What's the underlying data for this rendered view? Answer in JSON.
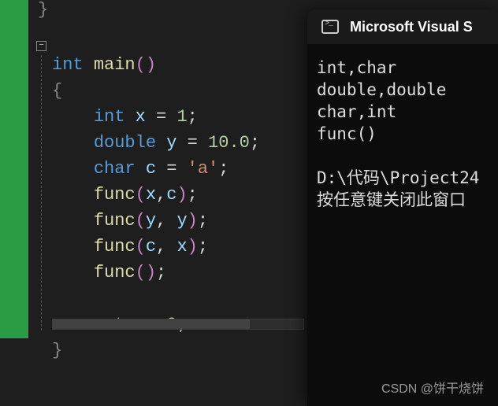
{
  "editor": {
    "fold_glyph": "−",
    "prev_brace": "}",
    "lines": {
      "l0": {
        "kw": "int",
        "fn": "main",
        "p1": "(",
        "p2": ")"
      },
      "l1": {
        "brace": "{"
      },
      "l2": {
        "kw": "int",
        "id": "x",
        "op": "=",
        "num": "1",
        "semi": ";"
      },
      "l3": {
        "kw": "double",
        "id": "y",
        "op": "=",
        "num": "10.0",
        "semi": ";"
      },
      "l4": {
        "kw": "char",
        "id": "c",
        "op": "=",
        "str": "'a'",
        "semi": ";"
      },
      "l5": {
        "fn": "func",
        "p1": "(",
        "a1": "x",
        "comma": ",",
        "a2": "c",
        "p2": ")",
        "semi": ";"
      },
      "l6": {
        "fn": "func",
        "p1": "(",
        "a1": "y",
        "comma": ", ",
        "a2": "y",
        "p2": ")",
        "semi": ";"
      },
      "l7": {
        "fn": "func",
        "p1": "(",
        "a1": "c",
        "comma": ", ",
        "a2": "x",
        "p2": ")",
        "semi": ";"
      },
      "l8": {
        "fn": "func",
        "p1": "(",
        "p2": ")",
        "semi": ";"
      },
      "l9": {
        "kw": "return",
        "num": "0",
        "semi": ";"
      },
      "l10": {
        "brace": "}"
      }
    }
  },
  "console": {
    "title": "Microsoft Visual S",
    "out1": "int,char",
    "out2": "double,double",
    "out3": "char,int",
    "out4": "func()",
    "blank": "",
    "out5": "D:\\代码\\Project24",
    "out6": "按任意键关闭此窗口"
  },
  "watermark": "CSDN @饼干烧饼"
}
